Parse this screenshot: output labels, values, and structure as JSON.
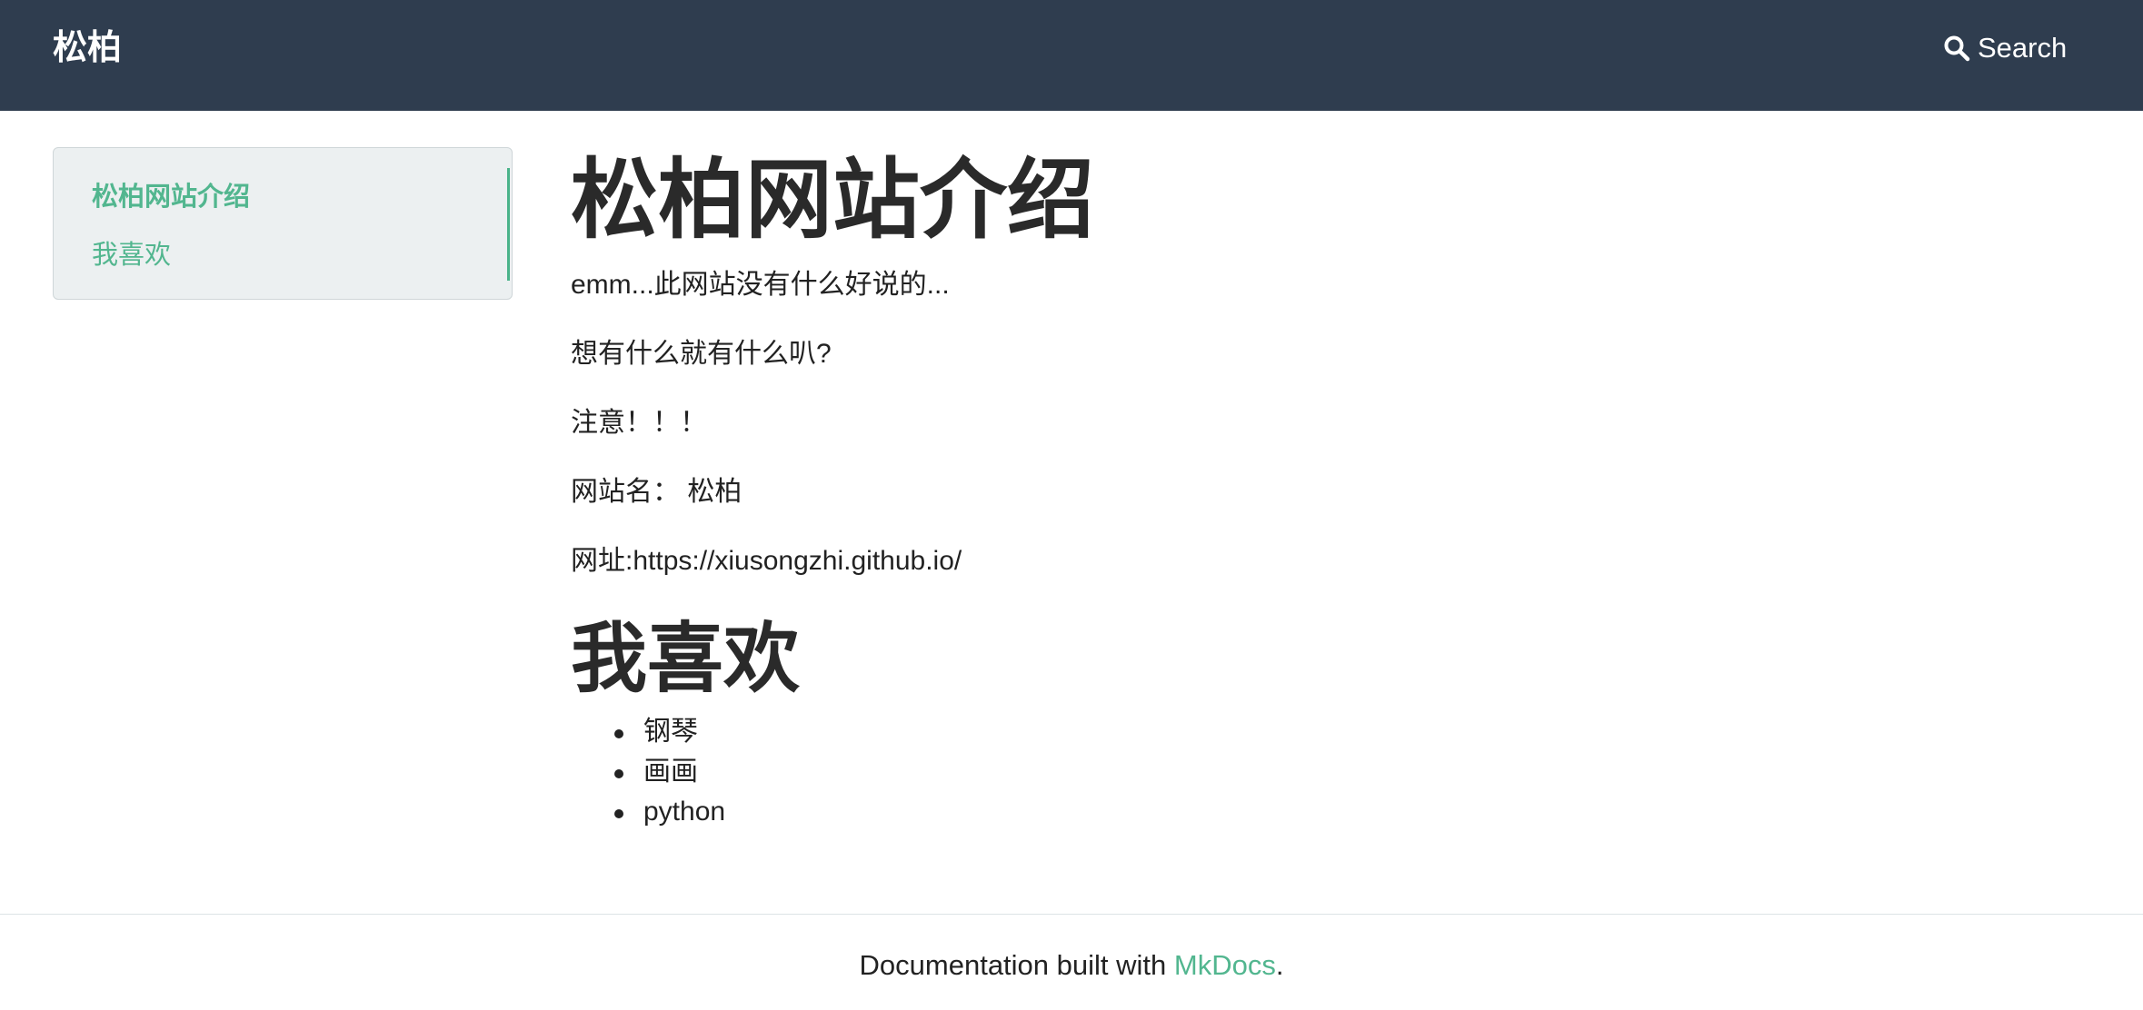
{
  "navbar": {
    "brand": "松柏",
    "search_label": "Search"
  },
  "sidebar": {
    "items": [
      {
        "label": "松柏网站介绍",
        "active": true
      },
      {
        "label": "我喜欢",
        "active": false
      }
    ]
  },
  "content": {
    "heading1": "松柏网站介绍",
    "paragraphs": [
      "emm...此网站没有什么好说的...",
      "想有什么就有什么叭?",
      "注意！！！",
      "网站名： 松柏",
      "网址:https://xiusongzhi.github.io/"
    ],
    "heading2": "我喜欢",
    "list": [
      "钢琴",
      "画画",
      "python"
    ]
  },
  "footer": {
    "prefix": "Documentation built with ",
    "link": "MkDocs",
    "suffix": "."
  },
  "colors": {
    "navbar_bg": "#2f3d4f",
    "link_green": "#52b68f",
    "sidebar_bg": "#ecf0f1"
  }
}
